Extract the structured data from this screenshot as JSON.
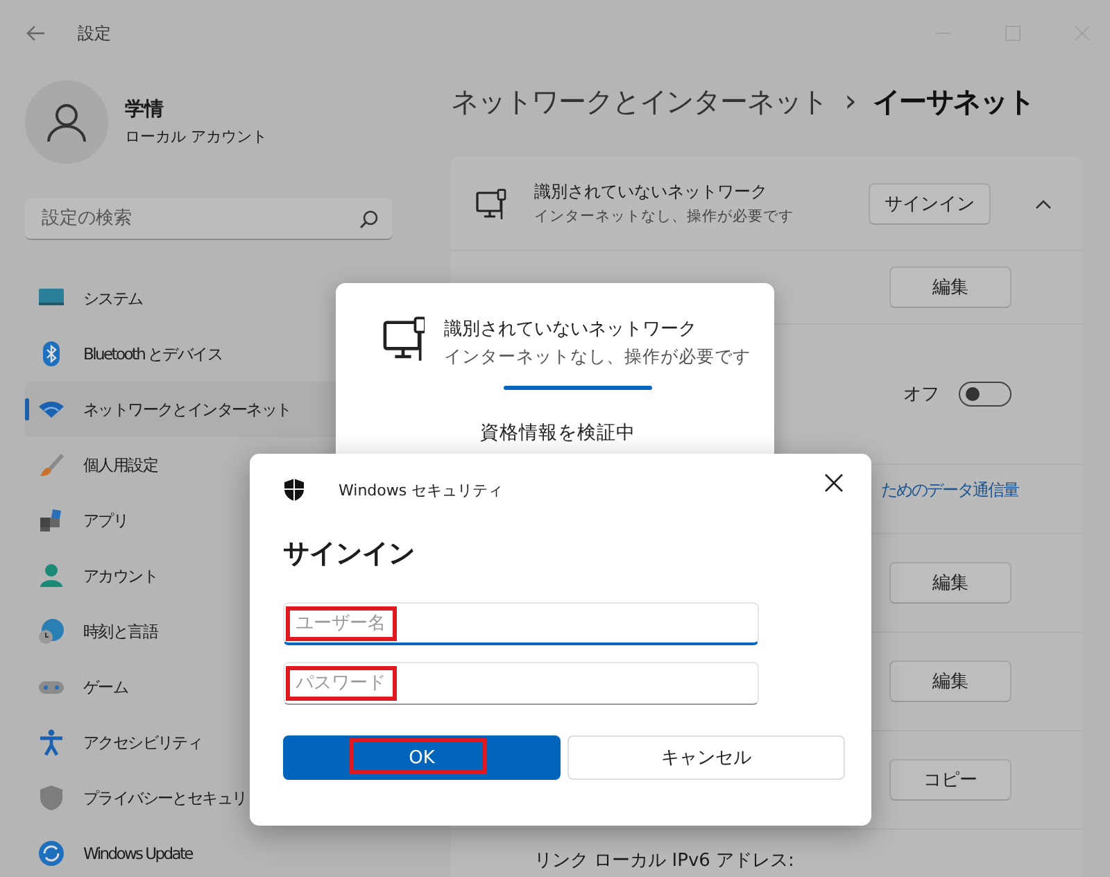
{
  "window": {
    "title": "設定"
  },
  "profile": {
    "name": "学情",
    "account_type": "ローカル アカウント"
  },
  "search": {
    "placeholder": "設定の検索"
  },
  "nav": [
    {
      "kind": "system",
      "label": "システム",
      "selected": false
    },
    {
      "kind": "bluetooth",
      "label": "Bluetooth とデバイス",
      "selected": false
    },
    {
      "kind": "network",
      "label": "ネットワークとインターネット",
      "selected": true
    },
    {
      "kind": "personalize",
      "label": "個人用設定",
      "selected": false
    },
    {
      "kind": "apps",
      "label": "アプリ",
      "selected": false
    },
    {
      "kind": "account",
      "label": "アカウント",
      "selected": false
    },
    {
      "kind": "time",
      "label": "時刻と言語",
      "selected": false
    },
    {
      "kind": "game",
      "label": "ゲーム",
      "selected": false
    },
    {
      "kind": "accessibility",
      "label": "アクセシビリティ",
      "selected": false
    },
    {
      "kind": "privacy",
      "label": "プライバシーとセキュリ",
      "selected": false
    },
    {
      "kind": "update",
      "label": "Windows Update",
      "selected": false
    }
  ],
  "breadcrumb": {
    "parent": "ネットワークとインターネット",
    "separator": "›",
    "current": "イーサネット"
  },
  "settings_rows": [
    {
      "kind": "network",
      "title": "識別されていないネットワーク",
      "subtitle": "インターネットなし、操作が必要です",
      "button": "サインイン",
      "expanded": true
    },
    {
      "kind": "button",
      "button": "編集"
    },
    {
      "kind": "toggle",
      "state_label": "オフ",
      "on": false
    },
    {
      "kind": "link",
      "link": "ためのデータ通信量"
    },
    {
      "kind": "button",
      "button": "編集"
    },
    {
      "kind": "button",
      "button": "編集"
    },
    {
      "kind": "button",
      "button": "コピー"
    },
    {
      "kind": "label",
      "label": "リンク ローカル IPv6 アドレス:"
    }
  ],
  "flyout": {
    "title": "識別されていないネットワーク",
    "subtitle": "インターネットなし、操作が必要です",
    "status": "資格情報を検証中"
  },
  "dialog": {
    "app": "Windows セキュリティ",
    "heading": "サインイン",
    "fields": [
      {
        "placeholder": "ユーザー名",
        "focused": true,
        "highlighted": true
      },
      {
        "placeholder": "パスワード",
        "focused": false,
        "highlighted": true
      }
    ],
    "buttons": [
      {
        "label": "OK",
        "primary": true,
        "highlighted": true
      },
      {
        "label": "キャンセル",
        "primary": false,
        "highlighted": false
      }
    ]
  }
}
